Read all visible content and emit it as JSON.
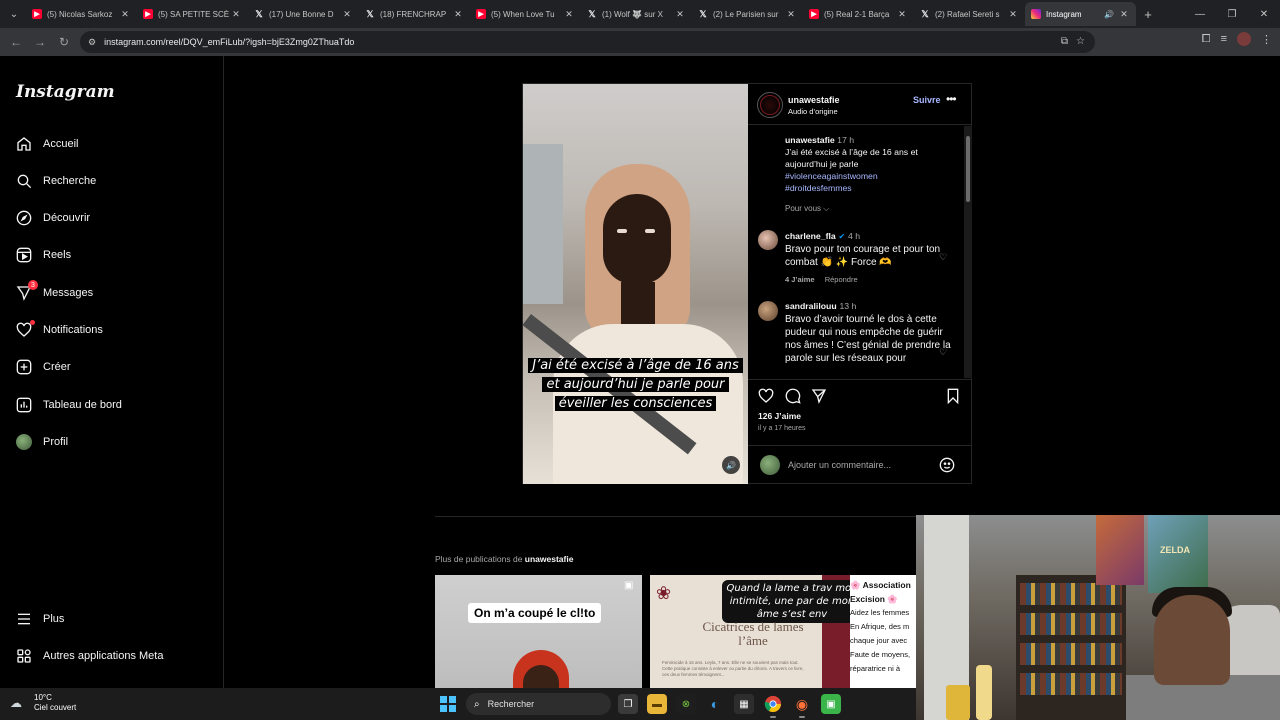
{
  "browser": {
    "tabs": [
      {
        "title": "(5) Nicolas Sarkoz",
        "favicon": "youtube-icon",
        "active": false
      },
      {
        "title": "(5) SA PETITE SCÈ",
        "favicon": "youtube-icon",
        "active": false
      },
      {
        "title": "(17) Une Bonne D",
        "favicon": "x-icon",
        "active": false
      },
      {
        "title": "(18) FRENCHRAP",
        "favicon": "x-icon",
        "active": false
      },
      {
        "title": "(5) When Love Tu",
        "favicon": "youtube-icon",
        "active": false
      },
      {
        "title": "(1) Wolf 🐺 sur X",
        "favicon": "x-icon",
        "active": false
      },
      {
        "title": "(2) Le Parisien sur",
        "favicon": "x-icon",
        "active": false
      },
      {
        "title": "(5) Real 2-1 Barça",
        "favicon": "youtube-icon",
        "active": false
      },
      {
        "title": "(2) Rafael Sereti s",
        "favicon": "x-icon",
        "active": false
      },
      {
        "title": "Instagram",
        "favicon": "instagram-icon",
        "active": true
      }
    ],
    "url": "instagram.com/reel/DQV_emFiLub/?igsh=bjE3Zmg0ZThuaTdo"
  },
  "sidenav": {
    "logo": "Instagram",
    "items": [
      {
        "label": "Accueil",
        "icon": "home-icon"
      },
      {
        "label": "Recherche",
        "icon": "search-icon"
      },
      {
        "label": "Découvrir",
        "icon": "compass-icon"
      },
      {
        "label": "Reels",
        "icon": "reels-icon"
      },
      {
        "label": "Messages",
        "icon": "messenger-icon",
        "badge": "3"
      },
      {
        "label": "Notifications",
        "icon": "heart-icon"
      },
      {
        "label": "Créer",
        "icon": "plus-square-icon"
      },
      {
        "label": "Tableau de bord",
        "icon": "dashboard-icon"
      },
      {
        "label": "Profil",
        "icon": "avatar"
      }
    ],
    "bottom": [
      {
        "label": "Plus",
        "icon": "hamburger-icon"
      },
      {
        "label": "Autres applications Meta",
        "icon": "meta-apps-icon"
      }
    ]
  },
  "post": {
    "username": "unawestafie",
    "audio": "Audio d’origine",
    "follow": "Suivre",
    "video_caption": "J’ai été excisé à l’âge de 16 ans et aujourd’hui je parle pour éveiller les consciences",
    "caption": {
      "username": "unawestafie",
      "time": "17 h",
      "text": "J’ai été excisé à l’âge de 16 ans et aujourd’hui je parle",
      "hashtags": [
        "#violenceagainstwomen",
        "#droitdesfemmes"
      ],
      "see_translation": "Pour vous ⌵"
    },
    "comments": [
      {
        "username": "charlene_fla",
        "verified": true,
        "time": "4 h",
        "text": "Bravo pour ton courage et pour ton combat 👏 ✨ Force 🫶",
        "likes": "4 J’aime",
        "reply": "Répondre"
      },
      {
        "username": "sandralilouu",
        "verified": false,
        "time": "13 h",
        "text": "Bravo d’avoir tourné le dos à cette pudeur qui nous empêche de guérir nos âmes ! C’est génial de prendre la parole sur les réseaux pour",
        "likes": "",
        "reply": ""
      }
    ],
    "likes": "126 J’aime",
    "age": "il y a 17 heures",
    "comment_placeholder": "Ajouter un commentaire..."
  },
  "more_posts": {
    "label": "Plus de publications de",
    "username": "unawestafie",
    "thumbs": [
      {
        "text": "On m’a coupé le cl!to"
      },
      {
        "bubble": "Quand la lame a trav mon intimité, une par de mon âme s’est env",
        "title": "Cicatrices de lames l’âme",
        "body": "Feminicide à 16 ans. Leyla, 7 ans. Elle ne se souvient pas mais tout. Cette pratique consiste à enlever ou partie du clitoris. A travers ce livre, ces deux femmes témoignent..."
      },
      {
        "title": "🌸 Association Excision 🌸",
        "body": "Aidez les femmes En Afrique, des m chaque jour avec Faute de moyens, réparatrice ni à"
      }
    ]
  },
  "webcam": {
    "poster_text": "ZELDA"
  },
  "taskbar": {
    "weather_temp": "10°C",
    "weather_desc": "Ciel couvert",
    "search_label": "Rechercher"
  }
}
